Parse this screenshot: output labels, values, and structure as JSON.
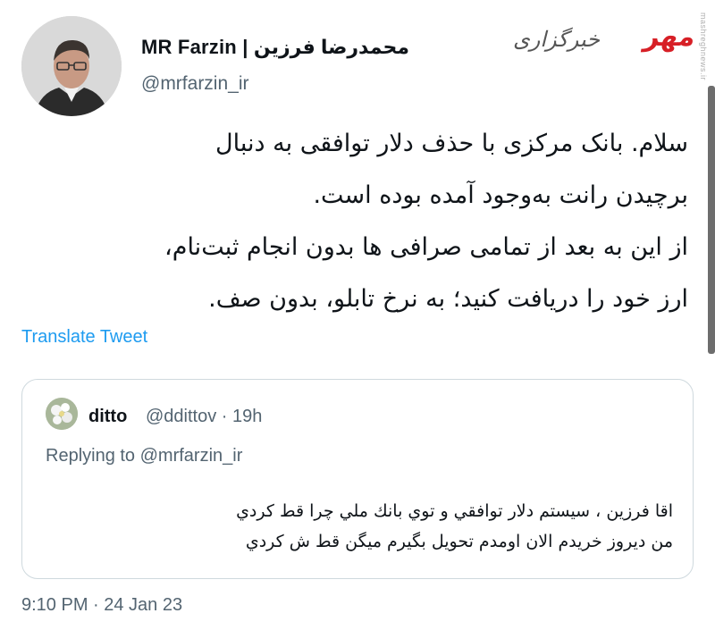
{
  "author": {
    "name": "MR Farzin | محمدرضا فرزین",
    "handle": "@mrfarzin_ir",
    "avatar_icon": "profile-photo"
  },
  "branding": {
    "logo_mark": "مهر",
    "logo_sub": "خبرگزاری",
    "logo_color": "#d71f26",
    "watermark": "mashreghnews.ir"
  },
  "tweet": {
    "lines": [
      "سلام. بانک مرکزی با حذف دلار توافقی به دنبال",
      "برچیدن رانت به‌وجود آمده بوده است.",
      "از این به بعد از تمامی صرافی ها بدون انجام ثبت‌نام،",
      "ارز خود را دریافت کنید؛ به نرخ تابلو، بدون صف."
    ],
    "translate_label": "Translate Tweet",
    "timestamp": "9:10 PM · 24 Jan 23"
  },
  "quoted": {
    "name": "ditto",
    "handle_time": "@ddittov · 19h",
    "replying_label": "Replying to @mrfarzin_ir",
    "lines": [
      "اقا فرزين ، سيستم دلار توافقي و توي بانك ملي چرا قط كردي",
      "من ديروز خريدم الان اومدم تحويل بگيرم ميگن قط ش كردي"
    ],
    "avatar_icon": "flower-avatar"
  },
  "colors": {
    "link": "#1d9bf0",
    "secondary_text": "#536471",
    "border": "#cfd9de"
  }
}
